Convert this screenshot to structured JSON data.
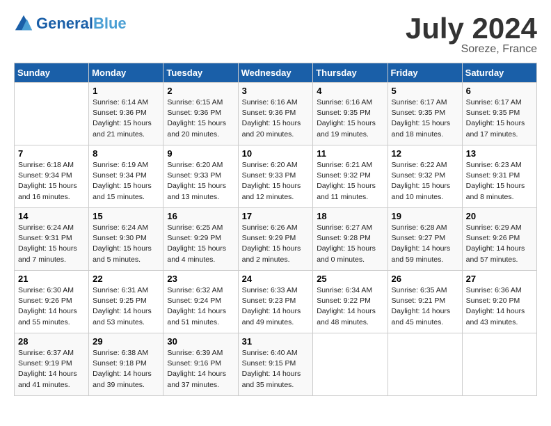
{
  "header": {
    "logo_general": "General",
    "logo_blue": "Blue",
    "month_year": "July 2024",
    "location": "Soreze, France"
  },
  "days_of_week": [
    "Sunday",
    "Monday",
    "Tuesday",
    "Wednesday",
    "Thursday",
    "Friday",
    "Saturday"
  ],
  "weeks": [
    [
      {
        "day": "",
        "sunrise": "",
        "sunset": "",
        "daylight": ""
      },
      {
        "day": "1",
        "sunrise": "Sunrise: 6:14 AM",
        "sunset": "Sunset: 9:36 PM",
        "daylight": "Daylight: 15 hours and 21 minutes."
      },
      {
        "day": "2",
        "sunrise": "Sunrise: 6:15 AM",
        "sunset": "Sunset: 9:36 PM",
        "daylight": "Daylight: 15 hours and 20 minutes."
      },
      {
        "day": "3",
        "sunrise": "Sunrise: 6:16 AM",
        "sunset": "Sunset: 9:36 PM",
        "daylight": "Daylight: 15 hours and 20 minutes."
      },
      {
        "day": "4",
        "sunrise": "Sunrise: 6:16 AM",
        "sunset": "Sunset: 9:35 PM",
        "daylight": "Daylight: 15 hours and 19 minutes."
      },
      {
        "day": "5",
        "sunrise": "Sunrise: 6:17 AM",
        "sunset": "Sunset: 9:35 PM",
        "daylight": "Daylight: 15 hours and 18 minutes."
      },
      {
        "day": "6",
        "sunrise": "Sunrise: 6:17 AM",
        "sunset": "Sunset: 9:35 PM",
        "daylight": "Daylight: 15 hours and 17 minutes."
      }
    ],
    [
      {
        "day": "7",
        "sunrise": "Sunrise: 6:18 AM",
        "sunset": "Sunset: 9:34 PM",
        "daylight": "Daylight: 15 hours and 16 minutes."
      },
      {
        "day": "8",
        "sunrise": "Sunrise: 6:19 AM",
        "sunset": "Sunset: 9:34 PM",
        "daylight": "Daylight: 15 hours and 15 minutes."
      },
      {
        "day": "9",
        "sunrise": "Sunrise: 6:20 AM",
        "sunset": "Sunset: 9:33 PM",
        "daylight": "Daylight: 15 hours and 13 minutes."
      },
      {
        "day": "10",
        "sunrise": "Sunrise: 6:20 AM",
        "sunset": "Sunset: 9:33 PM",
        "daylight": "Daylight: 15 hours and 12 minutes."
      },
      {
        "day": "11",
        "sunrise": "Sunrise: 6:21 AM",
        "sunset": "Sunset: 9:32 PM",
        "daylight": "Daylight: 15 hours and 11 minutes."
      },
      {
        "day": "12",
        "sunrise": "Sunrise: 6:22 AM",
        "sunset": "Sunset: 9:32 PM",
        "daylight": "Daylight: 15 hours and 10 minutes."
      },
      {
        "day": "13",
        "sunrise": "Sunrise: 6:23 AM",
        "sunset": "Sunset: 9:31 PM",
        "daylight": "Daylight: 15 hours and 8 minutes."
      }
    ],
    [
      {
        "day": "14",
        "sunrise": "Sunrise: 6:24 AM",
        "sunset": "Sunset: 9:31 PM",
        "daylight": "Daylight: 15 hours and 7 minutes."
      },
      {
        "day": "15",
        "sunrise": "Sunrise: 6:24 AM",
        "sunset": "Sunset: 9:30 PM",
        "daylight": "Daylight: 15 hours and 5 minutes."
      },
      {
        "day": "16",
        "sunrise": "Sunrise: 6:25 AM",
        "sunset": "Sunset: 9:29 PM",
        "daylight": "Daylight: 15 hours and 4 minutes."
      },
      {
        "day": "17",
        "sunrise": "Sunrise: 6:26 AM",
        "sunset": "Sunset: 9:29 PM",
        "daylight": "Daylight: 15 hours and 2 minutes."
      },
      {
        "day": "18",
        "sunrise": "Sunrise: 6:27 AM",
        "sunset": "Sunset: 9:28 PM",
        "daylight": "Daylight: 15 hours and 0 minutes."
      },
      {
        "day": "19",
        "sunrise": "Sunrise: 6:28 AM",
        "sunset": "Sunset: 9:27 PM",
        "daylight": "Daylight: 14 hours and 59 minutes."
      },
      {
        "day": "20",
        "sunrise": "Sunrise: 6:29 AM",
        "sunset": "Sunset: 9:26 PM",
        "daylight": "Daylight: 14 hours and 57 minutes."
      }
    ],
    [
      {
        "day": "21",
        "sunrise": "Sunrise: 6:30 AM",
        "sunset": "Sunset: 9:26 PM",
        "daylight": "Daylight: 14 hours and 55 minutes."
      },
      {
        "day": "22",
        "sunrise": "Sunrise: 6:31 AM",
        "sunset": "Sunset: 9:25 PM",
        "daylight": "Daylight: 14 hours and 53 minutes."
      },
      {
        "day": "23",
        "sunrise": "Sunrise: 6:32 AM",
        "sunset": "Sunset: 9:24 PM",
        "daylight": "Daylight: 14 hours and 51 minutes."
      },
      {
        "day": "24",
        "sunrise": "Sunrise: 6:33 AM",
        "sunset": "Sunset: 9:23 PM",
        "daylight": "Daylight: 14 hours and 49 minutes."
      },
      {
        "day": "25",
        "sunrise": "Sunrise: 6:34 AM",
        "sunset": "Sunset: 9:22 PM",
        "daylight": "Daylight: 14 hours and 48 minutes."
      },
      {
        "day": "26",
        "sunrise": "Sunrise: 6:35 AM",
        "sunset": "Sunset: 9:21 PM",
        "daylight": "Daylight: 14 hours and 45 minutes."
      },
      {
        "day": "27",
        "sunrise": "Sunrise: 6:36 AM",
        "sunset": "Sunset: 9:20 PM",
        "daylight": "Daylight: 14 hours and 43 minutes."
      }
    ],
    [
      {
        "day": "28",
        "sunrise": "Sunrise: 6:37 AM",
        "sunset": "Sunset: 9:19 PM",
        "daylight": "Daylight: 14 hours and 41 minutes."
      },
      {
        "day": "29",
        "sunrise": "Sunrise: 6:38 AM",
        "sunset": "Sunset: 9:18 PM",
        "daylight": "Daylight: 14 hours and 39 minutes."
      },
      {
        "day": "30",
        "sunrise": "Sunrise: 6:39 AM",
        "sunset": "Sunset: 9:16 PM",
        "daylight": "Daylight: 14 hours and 37 minutes."
      },
      {
        "day": "31",
        "sunrise": "Sunrise: 6:40 AM",
        "sunset": "Sunset: 9:15 PM",
        "daylight": "Daylight: 14 hours and 35 minutes."
      },
      {
        "day": "",
        "sunrise": "",
        "sunset": "",
        "daylight": ""
      },
      {
        "day": "",
        "sunrise": "",
        "sunset": "",
        "daylight": ""
      },
      {
        "day": "",
        "sunrise": "",
        "sunset": "",
        "daylight": ""
      }
    ]
  ]
}
